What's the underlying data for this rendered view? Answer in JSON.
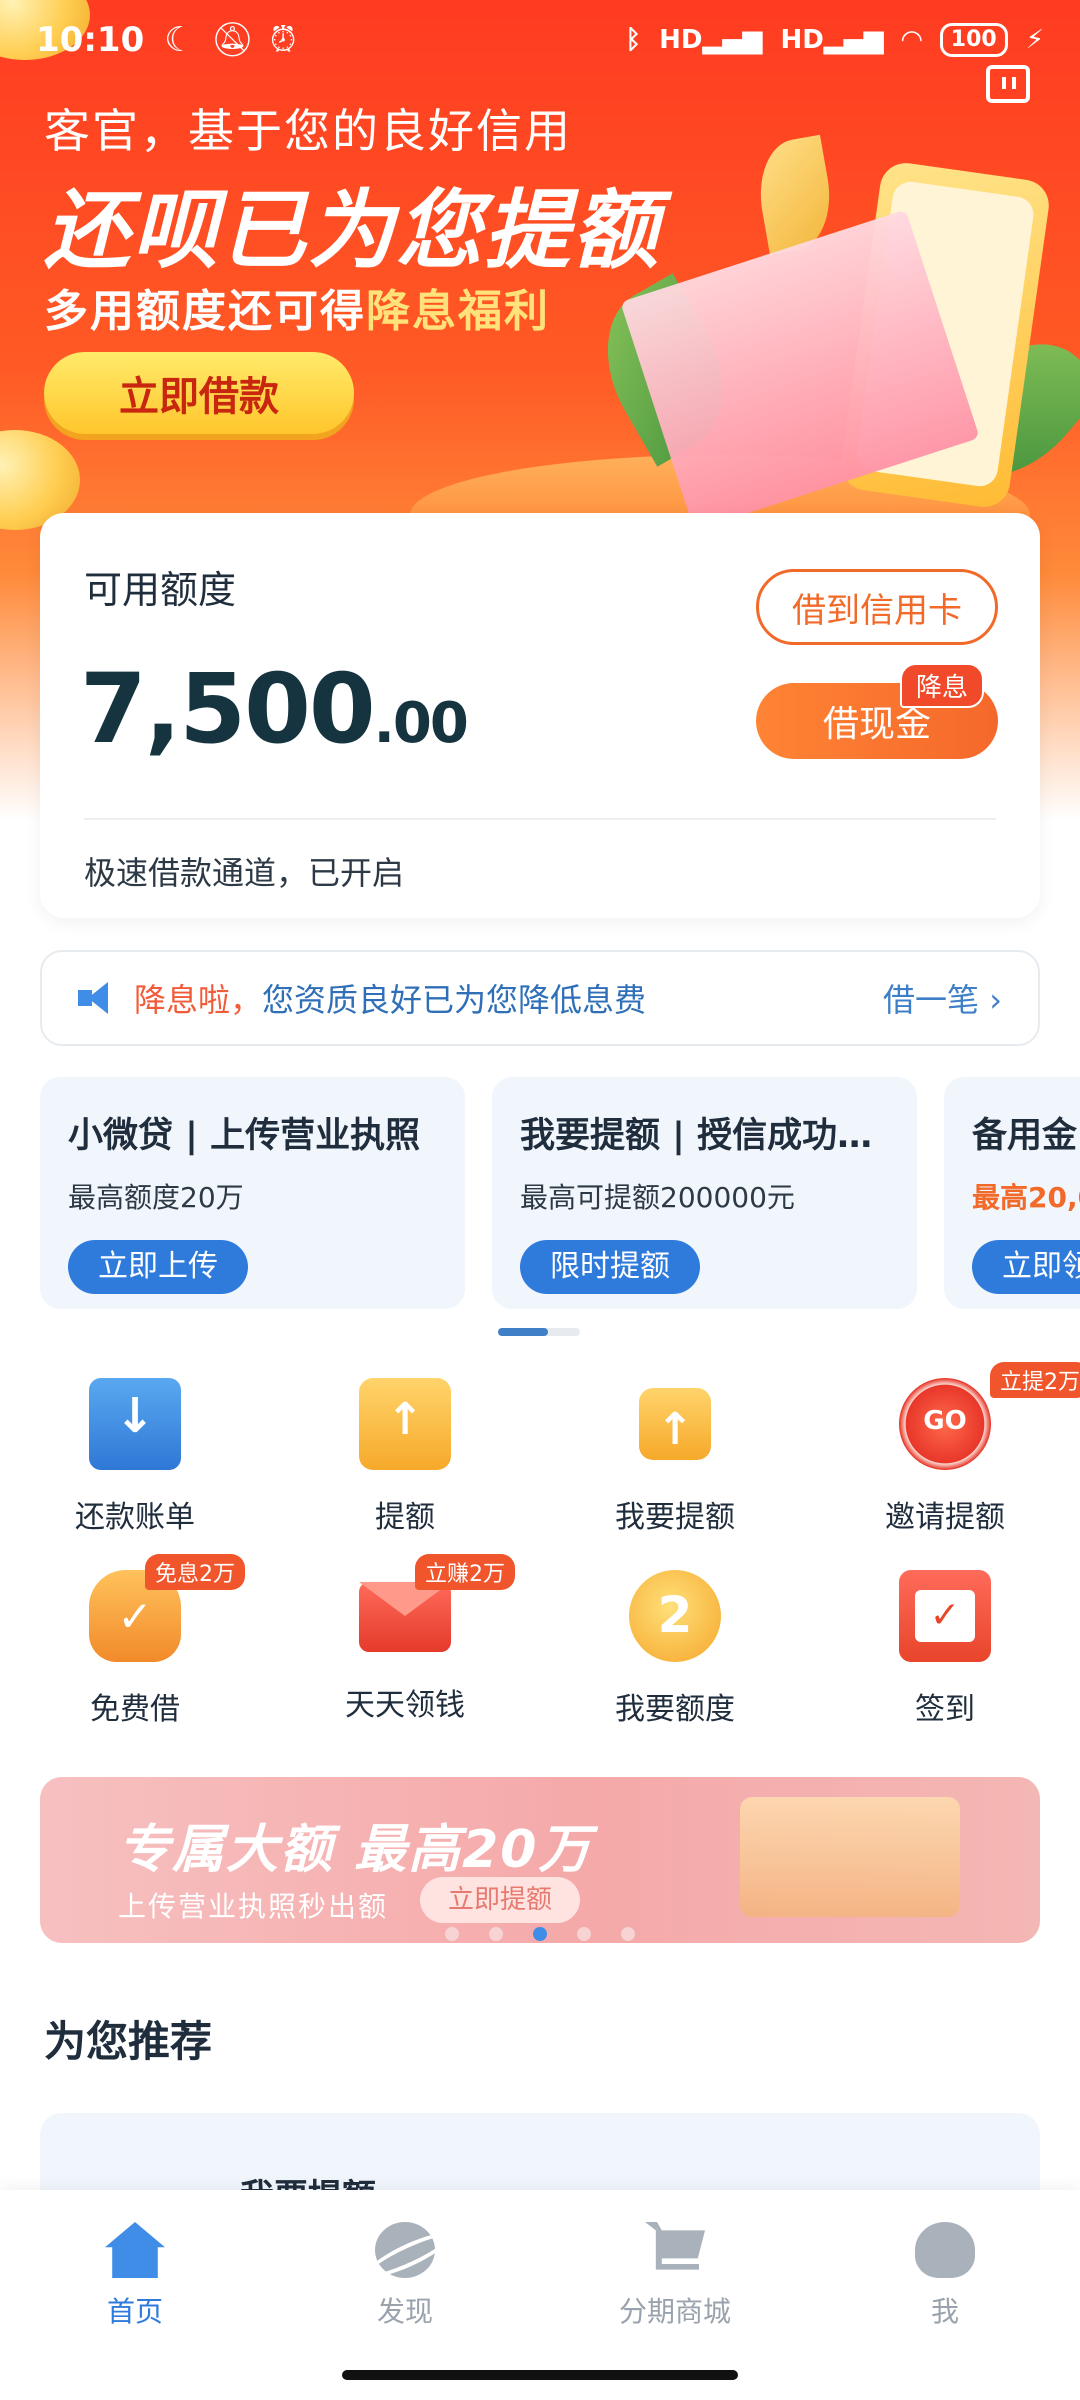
{
  "status_bar": {
    "time": "10:10",
    "left_icons": [
      "moon-icon",
      "bell-off-icon",
      "alarm-icon"
    ],
    "right_icons": [
      "bluetooth-icon",
      "signal-hd-icon",
      "signal-hd-icon",
      "wifi-icon"
    ],
    "signal_label_1": "HD",
    "signal_label_2": "HD",
    "battery": "100"
  },
  "hero": {
    "line1": "客官，基于您的良好信用",
    "title": "还呗已为您提额",
    "line3_prefix": "多用额度还可得",
    "line3_highlight": "降息福利",
    "button": "立即借款"
  },
  "credit": {
    "label": "可用额度",
    "amount_int": "7,500",
    "amount_dec": ".00",
    "btn_card": "借到信用卡",
    "btn_cash": "借现金",
    "badge": "降息",
    "footer": "极速借款通道，已开启"
  },
  "notice": {
    "prefix": "降息啦，",
    "text": "您资质良好已为您降低息费",
    "link": "借一笔 ›"
  },
  "promos": [
    {
      "title": "小微贷 | 上传营业执照",
      "sub": "最高额度20万",
      "button": "立即上传"
    },
    {
      "title": "我要提额 | 授信成功…",
      "sub": "最高可提额200000元",
      "button": "限时提额"
    },
    {
      "title": "备用金",
      "sub": "最高20,0",
      "button": "立即领"
    }
  ],
  "grid": [
    {
      "label": "还款账单",
      "icon": "bill-download-icon",
      "badge": ""
    },
    {
      "label": "提额",
      "icon": "wallet-up-icon",
      "badge": ""
    },
    {
      "label": "我要提额",
      "icon": "wallet-up-icon",
      "badge": ""
    },
    {
      "label": "邀请提额",
      "icon": "go-target-icon",
      "badge": "立提2万"
    },
    {
      "label": "免费借",
      "icon": "money-bag-icon",
      "badge": "免息2万"
    },
    {
      "label": "天天领钱",
      "icon": "red-envelope-icon",
      "badge": "立赚2万"
    },
    {
      "label": "我要额度",
      "icon": "coin-2-icon",
      "badge": ""
    },
    {
      "label": "签到",
      "icon": "calendar-check-icon",
      "badge": ""
    }
  ],
  "banner": {
    "title": "专属大额 最高20万",
    "sub": "上传营业执照秒出额",
    "button": "立即提额",
    "active_dot": 2,
    "dot_count": 5
  },
  "section_title": "为您推荐",
  "recommend": {
    "title": "我要提额"
  },
  "nav": [
    {
      "label": "首页",
      "icon": "home-icon",
      "active": true
    },
    {
      "label": "发现",
      "icon": "planet-icon",
      "active": false
    },
    {
      "label": "分期商城",
      "icon": "cart-icon",
      "active": false
    },
    {
      "label": "我",
      "icon": "user-icon",
      "active": false
    }
  ]
}
